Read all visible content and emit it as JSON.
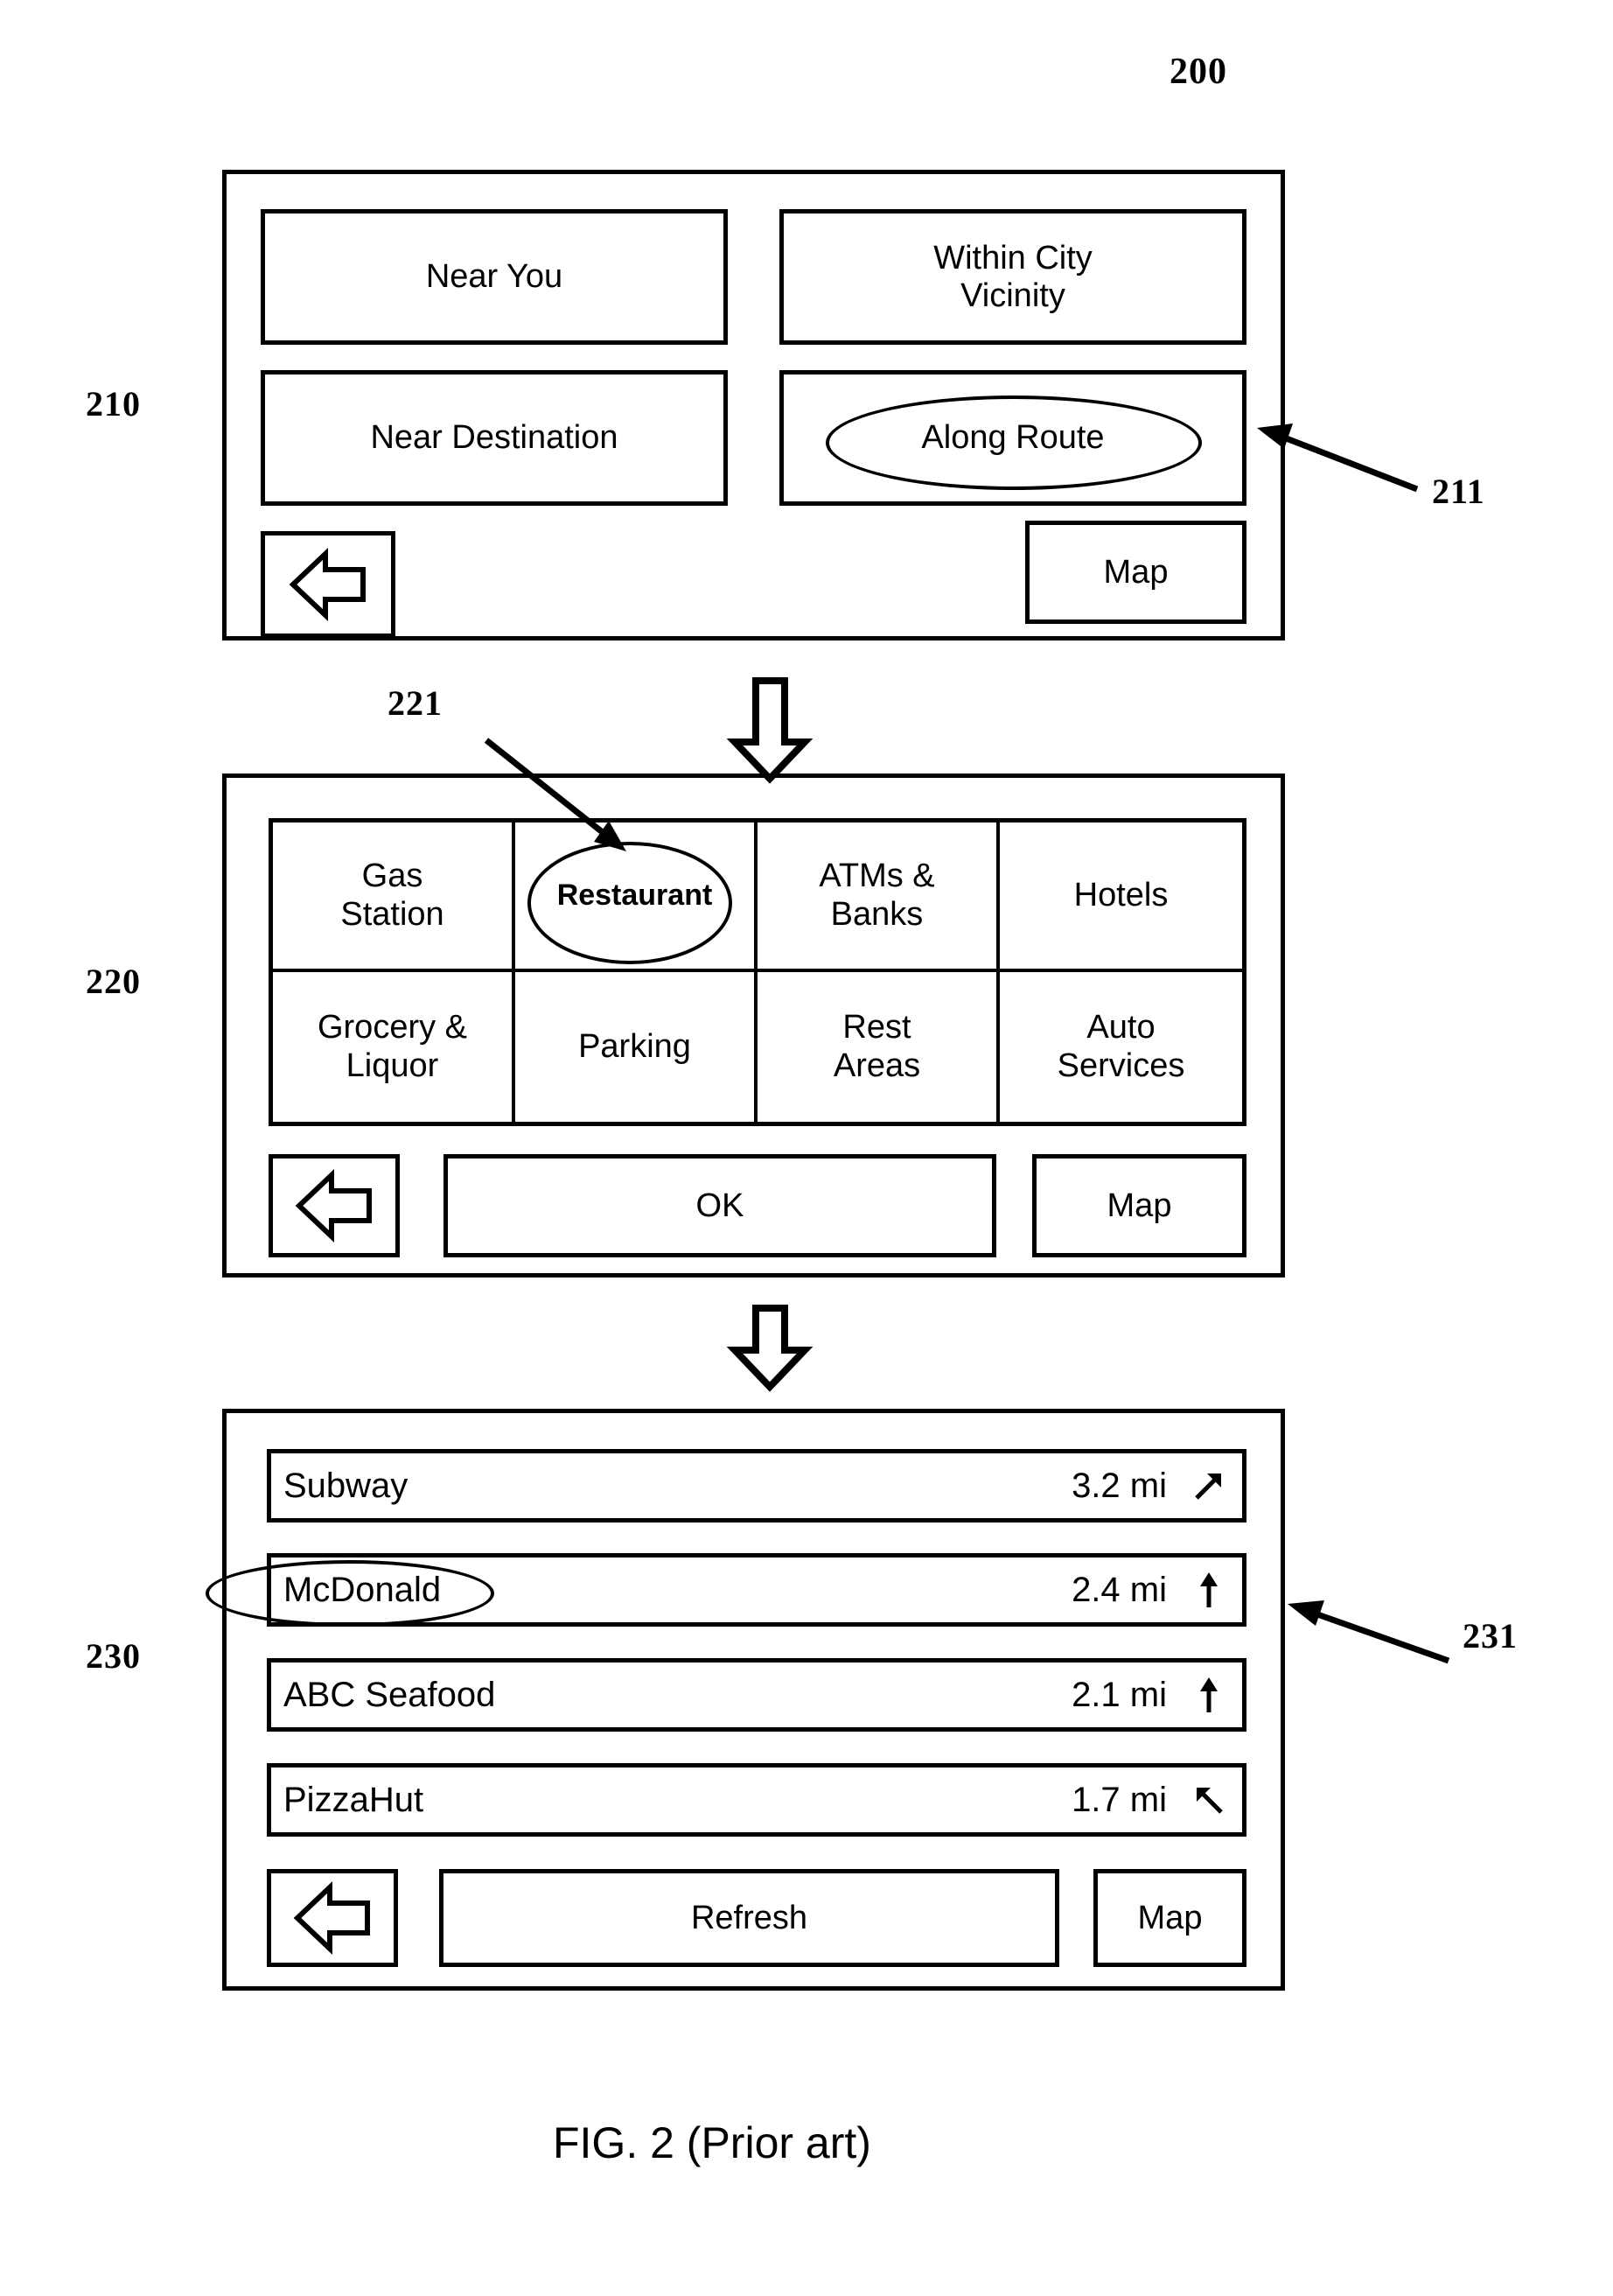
{
  "figure": {
    "top_reference": "200",
    "caption": "FIG. 2 (Prior art)"
  },
  "screens": [
    {
      "reference": "210",
      "name": "search-scope-screen",
      "buttons": [
        {
          "id": "near-you",
          "label": "Near You",
          "highlighted": false
        },
        {
          "id": "within-city",
          "label": "Within City\nVicinity",
          "highlighted": false
        },
        {
          "id": "near-destination",
          "label": "Near Destination",
          "highlighted": false
        },
        {
          "id": "along-route",
          "label": "Along Route",
          "highlighted": true
        }
      ],
      "highlight_reference": "211",
      "footer": {
        "back_icon": "back-arrow-icon",
        "map_label": "Map"
      }
    },
    {
      "reference": "220",
      "name": "category-screen",
      "categories": [
        {
          "id": "gas-station",
          "label": "Gas\nStation",
          "highlighted": false
        },
        {
          "id": "restaurant",
          "label": "Restaurant",
          "highlighted": true
        },
        {
          "id": "atms-banks",
          "label": "ATMs &\nBanks",
          "highlighted": false
        },
        {
          "id": "hotels",
          "label": "Hotels",
          "highlighted": false
        },
        {
          "id": "grocery-liquor",
          "label": "Grocery &\nLiquor",
          "highlighted": false
        },
        {
          "id": "parking",
          "label": "Parking",
          "highlighted": false
        },
        {
          "id": "rest-areas",
          "label": "Rest\nAreas",
          "highlighted": false
        },
        {
          "id": "auto-services",
          "label": "Auto\nServices",
          "highlighted": false
        }
      ],
      "highlight_reference": "221",
      "footer": {
        "back_icon": "back-arrow-icon",
        "ok_label": "OK",
        "map_label": "Map"
      }
    },
    {
      "reference": "230",
      "name": "results-screen",
      "results": [
        {
          "id": "subway",
          "name": "Subway",
          "distance": "3.2 mi",
          "direction": "arrow-up-right",
          "highlighted": false
        },
        {
          "id": "mcdonald",
          "name": "McDonald",
          "distance": "2.4 mi",
          "direction": "arrow-up",
          "highlighted": true
        },
        {
          "id": "abc-seafood",
          "name": "ABC Seafood",
          "distance": "2.1 mi",
          "direction": "arrow-up",
          "highlighted": false
        },
        {
          "id": "pizzahut",
          "name": "PizzaHut",
          "distance": "1.7 mi",
          "direction": "arrow-up-left",
          "highlighted": false
        }
      ],
      "highlight_reference": "231",
      "footer": {
        "back_icon": "back-arrow-icon",
        "refresh_label": "Refresh",
        "map_label": "Map"
      }
    }
  ],
  "flow_arrows": [
    {
      "id": "arrow-210-to-220",
      "from": "210",
      "to": "220",
      "icon": "down-arrow-icon"
    },
    {
      "id": "arrow-220-to-230",
      "from": "220",
      "to": "230",
      "icon": "down-arrow-icon"
    }
  ],
  "colors": {
    "ink": "#000000",
    "paper": "#ffffff"
  }
}
